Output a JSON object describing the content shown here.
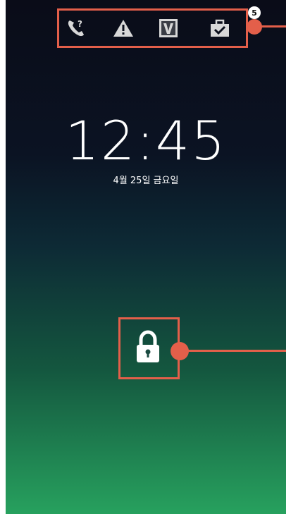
{
  "lock_screen": {
    "time": "12:45",
    "date": "4월 25일 금요일"
  },
  "notification_icons": [
    {
      "name": "missed-call-icon"
    },
    {
      "name": "warning-icon"
    },
    {
      "name": "v3-app-icon",
      "glyph": "V"
    },
    {
      "name": "task-briefcase-icon",
      "badge": "5"
    }
  ],
  "colors": {
    "callout": "#e35f4a",
    "gradient_top": "#0a0c18",
    "gradient_bottom": "#27a15e",
    "icon_color": "#d8d8d8"
  }
}
